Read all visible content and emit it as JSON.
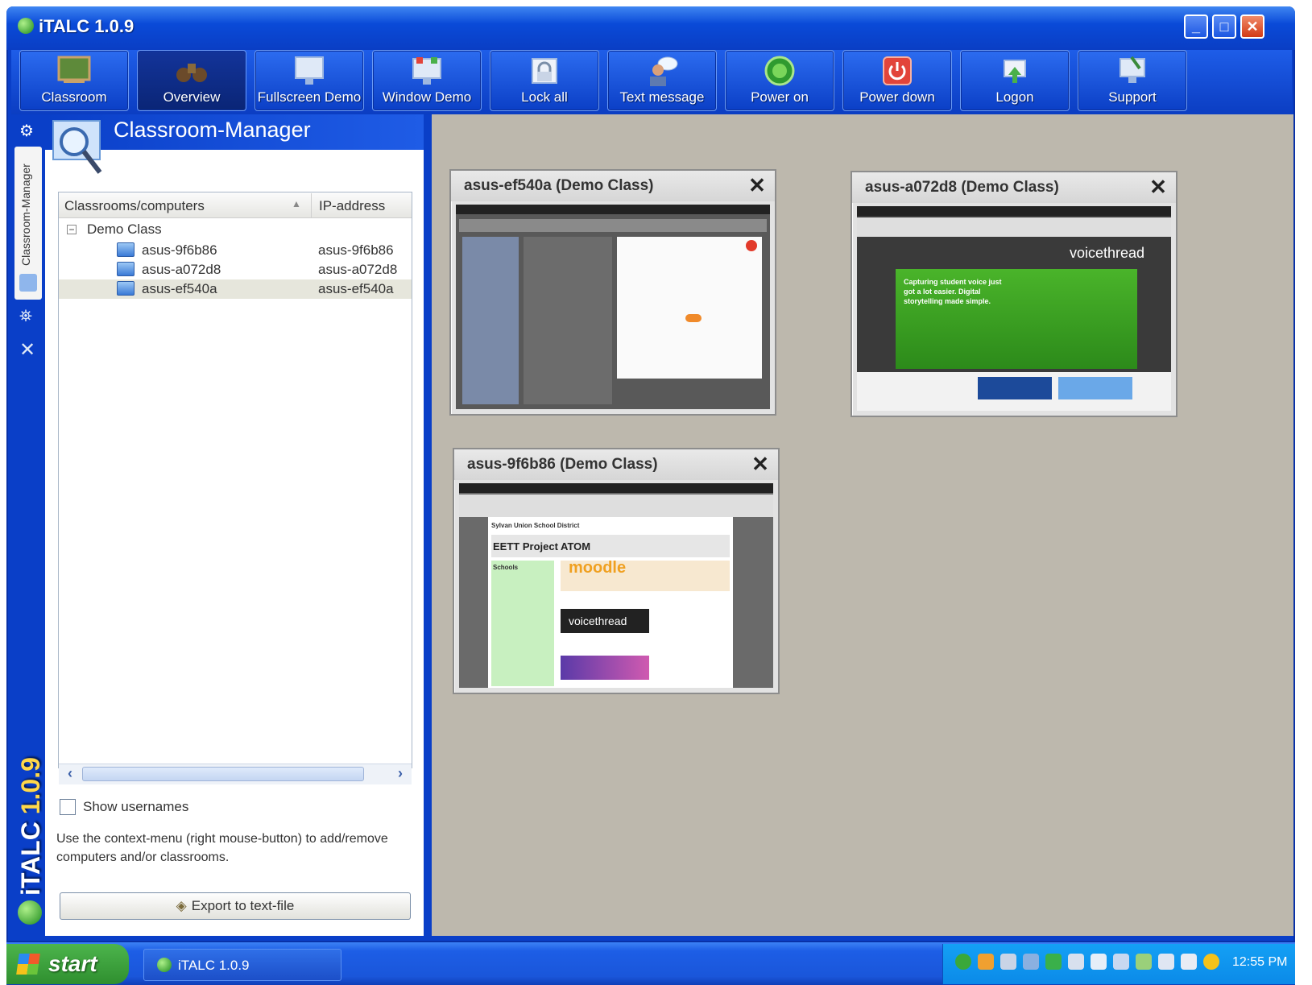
{
  "window": {
    "title": "iTALC 1.0.9"
  },
  "toolbar": {
    "buttons": [
      {
        "label": "Classroom",
        "icon": "classroom-icon"
      },
      {
        "label": "Overview",
        "icon": "binoculars-icon"
      },
      {
        "label": "Fullscreen Demo",
        "icon": "fullscreen-demo-icon"
      },
      {
        "label": "Window Demo",
        "icon": "window-demo-icon"
      },
      {
        "label": "Lock all",
        "icon": "lock-icon"
      },
      {
        "label": "Text message",
        "icon": "text-message-icon"
      },
      {
        "label": "Power on",
        "icon": "power-on-icon"
      },
      {
        "label": "Power down",
        "icon": "power-down-icon"
      },
      {
        "label": "Logon",
        "icon": "logon-icon"
      },
      {
        "label": "Support",
        "icon": "support-icon"
      }
    ]
  },
  "sidebar": {
    "tab_label": "Classroom-Manager",
    "brand": "iTALC",
    "brand_version": "1.0.9"
  },
  "panel": {
    "title": "Classroom-Manager",
    "columns": [
      "Classrooms/computers",
      "IP-address"
    ],
    "group": "Demo Class",
    "computers": [
      {
        "name": "asus-9f6b86",
        "ip": "asus-9f6b86"
      },
      {
        "name": "asus-a072d8",
        "ip": "asus-a072d8"
      },
      {
        "name": "asus-ef540a",
        "ip": "asus-ef540a"
      }
    ],
    "show_usernames_label": "Show usernames",
    "show_usernames_checked": false,
    "help_text": "Use the context-menu (right mouse-button) to add/remove computers and/or classrooms.",
    "export_label": "Export to text-file"
  },
  "snapshots": [
    {
      "title": "asus-ef540a (Demo Class)"
    },
    {
      "title": "asus-a072d8 (Demo Class)"
    },
    {
      "title": "asus-9f6b86 (Demo Class)"
    }
  ],
  "thumb_text": {
    "voicethread": "voicethread",
    "vt_heading": "Capturing student voice just got a lot easier. Digital storytelling made simple.",
    "moodle_district": "Sylvan Union School District",
    "moodle_project": "EETT Project ATOM",
    "moodle_logo": "moodle",
    "moodle_schools": "Schools"
  },
  "taskbar": {
    "start_label": "start",
    "task_label": "iTALC 1.0.9",
    "clock": "12:55 PM"
  },
  "colors": {
    "xp_blue": "#0a3fc8",
    "workspace": "#bdb8ad",
    "start_green": "#3a9a3a"
  }
}
